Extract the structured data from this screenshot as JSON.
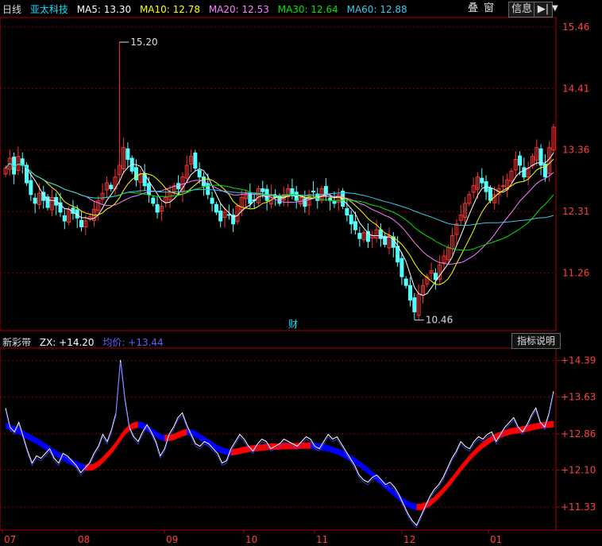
{
  "toolbar": {
    "period": "日线",
    "stock_name": "亚太科技",
    "overlay_label": "叠",
    "window_label": "窗",
    "info_label": "信息",
    "explain_label": "指标说明"
  },
  "colors": {
    "up": "#ff3232",
    "down": "#54ffff",
    "ma5": "#ffffff",
    "ma10": "#ffff00",
    "ma20": "#ff80ff",
    "ma30": "#00e600",
    "ma60": "#3cc8e6",
    "band_up": "#ff0000",
    "band_down": "#0000ff",
    "zx": "#ffffff",
    "avg": "#4040ff",
    "grid": "#8b0000",
    "axis": "#b00000"
  },
  "chart_data": [
    {
      "type": "candlestick",
      "title": "",
      "ma": [
        {
          "name": "MA5",
          "value": "13.30"
        },
        {
          "name": "MA10",
          "value": "12.78"
        },
        {
          "name": "MA20",
          "value": "12.53"
        },
        {
          "name": "MA30",
          "value": "12.64"
        },
        {
          "name": "MA60",
          "value": "12.88"
        }
      ],
      "ylim": [
        10.28,
        15.62
      ],
      "yticks": [
        "15.46",
        "14.41",
        "13.36",
        "12.31",
        "11.26"
      ],
      "high_label": "15.20",
      "low_label": "10.46",
      "event_marker": "财",
      "x_labels": [
        "07",
        "08",
        "09",
        "10",
        "11",
        "12",
        "01"
      ],
      "closes": [
        13.05,
        13.22,
        12.95,
        13.25,
        13.1,
        12.8,
        12.6,
        12.45,
        12.62,
        12.5,
        12.38,
        12.55,
        12.42,
        12.3,
        12.15,
        12.35,
        12.28,
        12.2,
        12.05,
        12.15,
        12.22,
        12.35,
        12.5,
        12.62,
        12.8,
        12.7,
        12.9,
        13.1,
        13.4,
        13.2,
        13.0,
        12.85,
        12.95,
        12.75,
        12.6,
        12.45,
        12.3,
        12.4,
        12.55,
        12.65,
        12.75,
        12.7,
        12.9,
        13.1,
        13.25,
        13.05,
        12.9,
        12.75,
        12.6,
        12.45,
        12.3,
        12.15,
        12.3,
        12.25,
        12.1,
        12.4,
        12.55,
        12.6,
        12.45,
        12.5,
        12.7,
        12.65,
        12.5,
        12.6,
        12.55,
        12.45,
        12.6,
        12.7,
        12.6,
        12.5,
        12.55,
        12.4,
        12.6,
        12.65,
        12.5,
        12.7,
        12.6,
        12.5,
        12.45,
        12.6,
        12.4,
        12.25,
        12.1,
        12.0,
        11.85,
        11.95,
        11.8,
        11.9,
        12.0,
        11.85,
        11.75,
        11.9,
        11.7,
        11.45,
        11.2,
        11.05,
        10.8,
        10.6,
        10.9,
        11.05,
        11.2,
        11.3,
        11.15,
        11.4,
        11.55,
        11.7,
        11.9,
        12.1,
        12.25,
        12.45,
        12.6,
        12.75,
        12.9,
        12.8,
        12.65,
        12.5,
        12.6,
        12.7,
        12.75,
        12.85,
        13.0,
        13.2,
        13.1,
        12.9,
        13.05,
        13.25,
        13.4,
        13.1,
        12.9,
        13.4,
        13.75
      ],
      "xlim": [
        0,
        130
      ]
    },
    {
      "type": "line",
      "title": "新彩带",
      "series": [
        {
          "name": "ZX",
          "value": "+14.20"
        },
        {
          "name": "均价",
          "value": "+13.44"
        }
      ],
      "ylim": [
        10.85,
        14.65
      ],
      "yticks": [
        "+14.39",
        "+13.63",
        "+12.86",
        "+12.10",
        "+11.33"
      ],
      "zx_values": [
        13.4,
        13.0,
        12.9,
        13.1,
        12.8,
        12.5,
        12.25,
        12.4,
        12.35,
        12.45,
        12.55,
        12.35,
        12.25,
        12.45,
        12.4,
        12.3,
        12.2,
        12.05,
        12.15,
        12.25,
        12.45,
        12.6,
        12.85,
        12.7,
        12.95,
        13.3,
        14.4,
        13.6,
        13.0,
        12.8,
        12.7,
        12.9,
        13.05,
        12.9,
        12.7,
        12.4,
        12.55,
        12.85,
        13.0,
        13.2,
        13.3,
        13.05,
        12.85,
        12.65,
        12.6,
        12.7,
        12.65,
        12.55,
        12.45,
        12.25,
        12.3,
        12.55,
        12.7,
        12.85,
        12.75,
        12.6,
        12.5,
        12.65,
        12.75,
        12.7,
        12.55,
        12.6,
        12.65,
        12.75,
        12.7,
        12.65,
        12.6,
        12.7,
        12.8,
        12.75,
        12.6,
        12.55,
        12.7,
        12.85,
        12.75,
        12.8,
        12.65,
        12.5,
        12.35,
        12.2,
        12.0,
        11.9,
        11.85,
        11.95,
        12.0,
        11.9,
        11.8,
        11.85,
        11.75,
        11.6,
        11.4,
        11.2,
        11.05,
        10.95,
        11.15,
        11.35,
        11.55,
        11.7,
        11.8,
        11.95,
        12.15,
        12.35,
        12.5,
        12.7,
        12.6,
        12.55,
        12.7,
        12.8,
        12.75,
        12.85,
        12.9,
        12.7,
        12.85,
        13.0,
        13.1,
        13.2,
        13.0,
        12.9,
        13.05,
        13.25,
        13.4,
        13.1,
        13.0,
        13.3,
        13.75
      ],
      "avg_values": [
        13.1,
        13.06,
        13.02,
        12.98,
        12.93,
        12.88,
        12.83,
        12.78,
        12.72,
        12.66,
        12.6,
        12.54,
        12.48,
        12.43,
        12.38,
        12.33,
        12.29,
        12.25,
        12.22,
        12.22,
        12.24,
        12.3,
        12.38,
        12.48,
        12.58,
        12.7,
        12.84,
        12.96,
        13.05,
        13.1,
        13.12,
        13.1,
        13.05,
        12.98,
        12.92,
        12.86,
        12.84,
        12.84,
        12.86,
        12.9,
        12.94,
        12.96,
        12.95,
        12.92,
        12.86,
        12.8,
        12.74,
        12.68,
        12.62,
        12.58,
        12.55,
        12.54,
        12.55,
        12.57,
        12.59,
        12.61,
        12.62,
        12.63,
        12.64,
        12.65,
        12.66,
        12.66,
        12.66,
        12.67,
        12.67,
        12.67,
        12.67,
        12.68,
        12.68,
        12.68,
        12.67,
        12.66,
        12.64,
        12.62,
        12.59,
        12.56,
        12.52,
        12.47,
        12.42,
        12.36,
        12.3,
        12.23,
        12.16,
        12.08,
        12.0,
        11.92,
        11.84,
        11.76,
        11.68,
        11.6,
        11.52,
        11.46,
        11.42,
        11.4,
        11.4,
        11.43,
        11.48,
        11.55,
        11.64,
        11.74,
        11.85,
        11.96,
        12.08,
        12.2,
        12.31,
        12.42,
        12.52,
        12.61,
        12.69,
        12.76,
        12.82,
        12.87,
        12.91,
        12.94,
        12.97,
        12.99,
        13.0,
        13.02,
        13.04,
        13.06,
        13.08,
        13.1,
        13.11,
        13.12,
        13.13
      ]
    }
  ]
}
